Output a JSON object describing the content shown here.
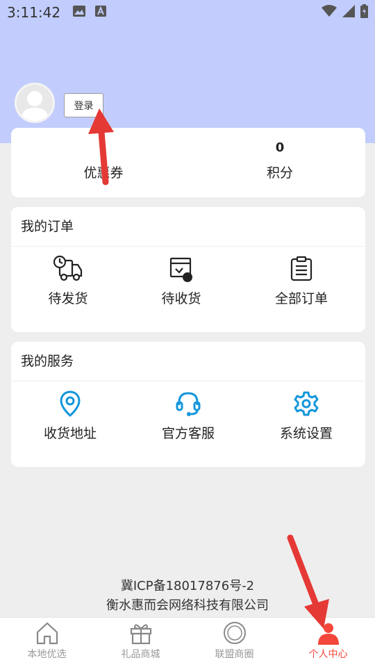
{
  "status_bar": {
    "time": "3:11:42"
  },
  "profile": {
    "login_label": "登录"
  },
  "stats": [
    {
      "value": "",
      "label": "优惠券"
    },
    {
      "value": "0",
      "label": "积分"
    }
  ],
  "orders": {
    "title": "我的订单",
    "items": [
      {
        "label": "待发货",
        "icon": "truck-icon"
      },
      {
        "label": "待收货",
        "icon": "receive-box-icon"
      },
      {
        "label": "全部订单",
        "icon": "order-list-icon"
      }
    ]
  },
  "services": {
    "title": "我的服务",
    "color": "#1296db",
    "items": [
      {
        "label": "收货地址",
        "icon": "location-pin-icon"
      },
      {
        "label": "官方客服",
        "icon": "headset-icon"
      },
      {
        "label": "系统设置",
        "icon": "gear-icon"
      }
    ]
  },
  "footer": {
    "icp": "冀ICP备18017876号-2",
    "company": "衡水惠而会网络科技有限公司"
  },
  "tabbar": {
    "active_color": "#f5463b",
    "tabs": [
      {
        "label": "本地优选",
        "icon": "home-icon"
      },
      {
        "label": "礼品商城",
        "icon": "gift-icon"
      },
      {
        "label": "联盟商圈",
        "icon": "circle-icon"
      },
      {
        "label": "个人中心",
        "icon": "person-icon",
        "active": true
      }
    ]
  }
}
